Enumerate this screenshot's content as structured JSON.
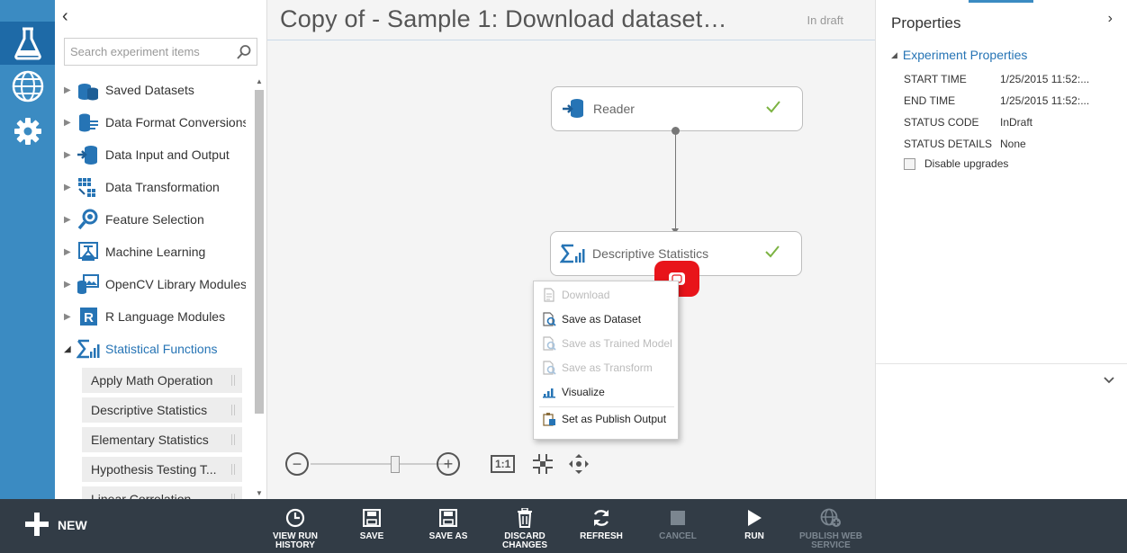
{
  "rail": {
    "items": [
      {
        "name": "experiments-icon"
      },
      {
        "name": "web-services-icon"
      },
      {
        "name": "settings-icon"
      }
    ]
  },
  "palette": {
    "collapse_glyph": "‹",
    "search_placeholder": "Search experiment items",
    "categories": [
      {
        "label": "Saved Datasets",
        "icon": "database-icon",
        "expanded": false
      },
      {
        "label": "Data Format Conversions",
        "icon": "format-conversion-icon",
        "expanded": false
      },
      {
        "label": "Data Input and Output",
        "icon": "input-output-icon",
        "expanded": false
      },
      {
        "label": "Data Transformation",
        "icon": "transformation-icon",
        "expanded": false
      },
      {
        "label": "Feature Selection",
        "icon": "feature-selection-icon",
        "expanded": false
      },
      {
        "label": "Machine Learning",
        "icon": "machine-learning-icon",
        "expanded": false
      },
      {
        "label": "OpenCV Library Modules",
        "icon": "opencv-icon",
        "expanded": false
      },
      {
        "label": "R Language Modules",
        "icon": "r-language-icon",
        "expanded": false
      },
      {
        "label": "Statistical Functions",
        "icon": "sigma-icon",
        "expanded": true
      }
    ],
    "sub_items": [
      "Apply Math Operation",
      "Descriptive Statistics",
      "Elementary Statistics",
      "Hypothesis Testing T...",
      "Linear Correlation"
    ]
  },
  "canvas": {
    "title": "Copy of - Sample 1: Download dataset…",
    "status": "In draft",
    "modules": [
      {
        "label": "Reader",
        "status": "complete"
      },
      {
        "label": "Descriptive Statistics",
        "status": "complete"
      }
    ],
    "context_menu": [
      {
        "label": "Download",
        "enabled": false,
        "icon": "document-icon"
      },
      {
        "label": "Save as Dataset",
        "enabled": true,
        "icon": "save-dataset-icon"
      },
      {
        "label": "Save as Trained Model",
        "enabled": false,
        "icon": "save-model-icon"
      },
      {
        "label": "Save as Transform",
        "enabled": false,
        "icon": "save-transform-icon"
      },
      {
        "label": "Visualize",
        "enabled": true,
        "icon": "visualize-icon"
      },
      {
        "label": "Set as Publish Output",
        "enabled": true,
        "icon": "publish-output-icon"
      }
    ],
    "zoom": {
      "minus": "−",
      "plus": "+",
      "one_to_one": "1:1",
      "level": 0.62
    }
  },
  "properties": {
    "title": "Properties",
    "expand_glyph": "›",
    "section": "Experiment Properties",
    "rows": [
      {
        "key": "START TIME",
        "value": "1/25/2015 11:52:..."
      },
      {
        "key": "END TIME",
        "value": "1/25/2015 11:52:..."
      },
      {
        "key": "STATUS CODE",
        "value": "InDraft"
      },
      {
        "key": "STATUS DETAILS",
        "value": "None"
      }
    ],
    "checkbox_label": "Disable upgrades"
  },
  "commands": {
    "new_label": "NEW",
    "items": [
      {
        "line1": "VIEW RUN",
        "line2": "HISTORY",
        "enabled": true,
        "icon": "history-icon"
      },
      {
        "line1": "SAVE",
        "line2": "",
        "enabled": true,
        "icon": "save-icon"
      },
      {
        "line1": "SAVE AS",
        "line2": "",
        "enabled": true,
        "icon": "save-as-icon"
      },
      {
        "line1": "DISCARD",
        "line2": "CHANGES",
        "enabled": true,
        "icon": "trash-icon"
      },
      {
        "line1": "REFRESH",
        "line2": "",
        "enabled": true,
        "icon": "refresh-icon"
      },
      {
        "line1": "CANCEL",
        "line2": "",
        "enabled": false,
        "icon": "stop-icon"
      },
      {
        "line1": "RUN",
        "line2": "",
        "enabled": true,
        "icon": "play-icon"
      },
      {
        "line1": "PUBLISH WEB",
        "line2": "SERVICE",
        "enabled": false,
        "icon": "globe-icon"
      }
    ]
  },
  "colors": {
    "rail": "#3b8bc2",
    "rail_active": "#1e6aa7",
    "accent": "#2674b5",
    "check": "#7cb342",
    "highlight": "#e8141a",
    "cmdbar": "#323c46"
  }
}
